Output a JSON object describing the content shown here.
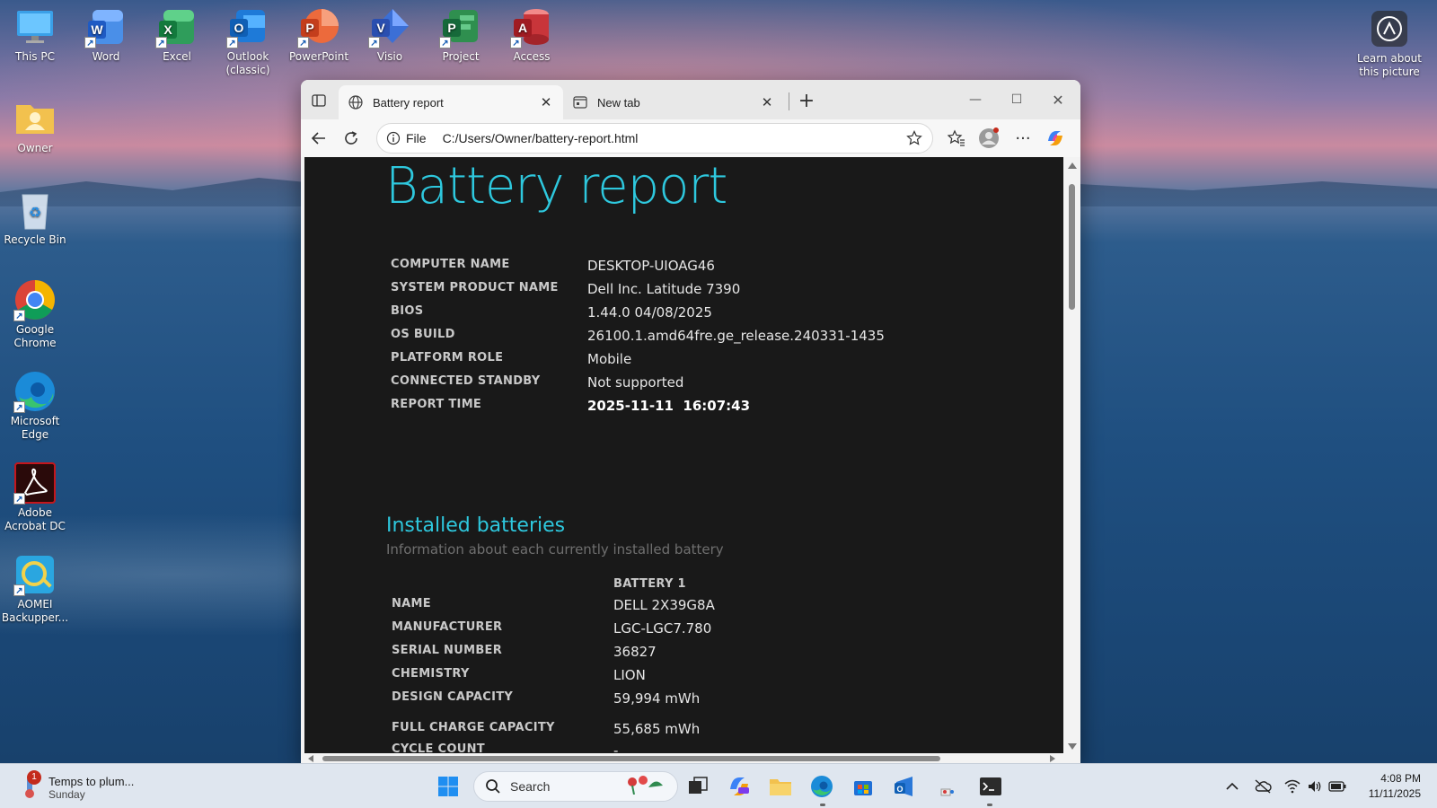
{
  "desktop": {
    "icons": [
      {
        "label": "This PC"
      },
      {
        "label": "Word"
      },
      {
        "label": "Excel"
      },
      {
        "label": "Outlook (classic)"
      },
      {
        "label": "PowerPoint"
      },
      {
        "label": "Visio"
      },
      {
        "label": "Project"
      },
      {
        "label": "Access"
      },
      {
        "label": "Owner"
      },
      {
        "label": "Recycle Bin"
      },
      {
        "label": "Google Chrome"
      },
      {
        "label": "Microsoft Edge"
      },
      {
        "label": "Adobe Acrobat DC"
      },
      {
        "label": "AOMEI Backupper..."
      }
    ],
    "learn_about": "Learn about this picture"
  },
  "browser": {
    "tabs": [
      {
        "title": "Battery report",
        "active": true
      },
      {
        "title": "New tab",
        "active": false
      }
    ],
    "address": {
      "scheme": "File",
      "url": "C:/Users/Owner/battery-report.html"
    }
  },
  "report": {
    "title": "Battery report",
    "system_info": [
      {
        "key": "COMPUTER NAME",
        "value": "DESKTOP-UIOAG46"
      },
      {
        "key": "SYSTEM PRODUCT NAME",
        "value": "Dell Inc. Latitude 7390"
      },
      {
        "key": "BIOS",
        "value": "1.44.0 04/08/2025"
      },
      {
        "key": "OS BUILD",
        "value": "26100.1.amd64fre.ge_release.240331-1435"
      },
      {
        "key": "PLATFORM ROLE",
        "value": "Mobile"
      },
      {
        "key": "CONNECTED STANDBY",
        "value": "Not supported"
      },
      {
        "key": "REPORT TIME",
        "value": "2025-11-11  16:07:43"
      }
    ],
    "installed_batteries": {
      "title": "Installed batteries",
      "subtitle": "Information about each currently installed battery",
      "column_header": "BATTERY 1",
      "rows": [
        {
          "key": "NAME",
          "value": "DELL 2X39G8A"
        },
        {
          "key": "MANUFACTURER",
          "value": "LGC-LGC7.780"
        },
        {
          "key": "SERIAL NUMBER",
          "value": "36827"
        },
        {
          "key": "CHEMISTRY",
          "value": "LION"
        },
        {
          "key": "DESIGN CAPACITY",
          "value": "59,994 mWh"
        },
        {
          "key": "FULL CHARGE CAPACITY",
          "value": "55,685 mWh"
        },
        {
          "key": "CYCLE COUNT",
          "value": "-"
        }
      ]
    }
  },
  "taskbar": {
    "weather_text": "Temps to plum...",
    "weather_sub": "Sunday",
    "weather_badge": "1",
    "search_placeholder": "Search",
    "time": "4:08 PM",
    "date": "11/11/2025"
  },
  "colors": {
    "accent": "#2ec8de",
    "report_bg": "#191919"
  }
}
